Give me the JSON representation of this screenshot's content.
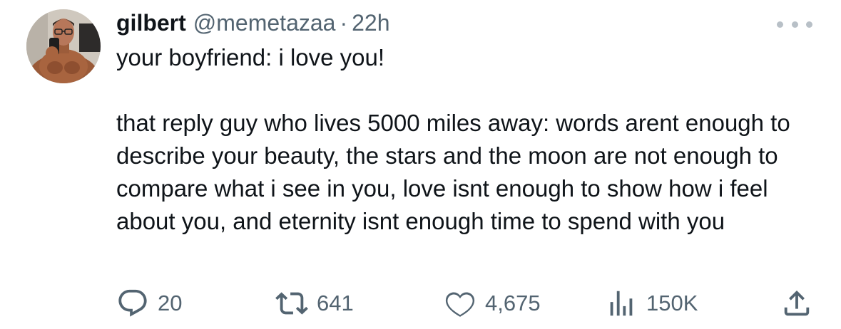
{
  "author": {
    "display_name": "gilbert",
    "handle": "@memetazaa",
    "separator": "·",
    "time": "22h"
  },
  "tweet": {
    "line1": "your boyfriend: i love you!",
    "line2": "that reply guy who lives 5000 miles away: words arent enough to describe your beauty, the stars and the moon are not enough to compare what i see in you, love isnt enough to show how i feel about you, and eternity isnt enough time to spend with you"
  },
  "actions": {
    "replies": "20",
    "reposts": "641",
    "likes": "4,675",
    "views": "150K"
  },
  "icons": {
    "reply": "reply-icon",
    "repost": "repost-icon",
    "like": "heart-icon",
    "views": "views-bar-icon",
    "share": "share-icon",
    "more": "more-dots-icon"
  },
  "colors": {
    "text": "#0f1419",
    "secondary": "#536471",
    "icon": "#536471"
  }
}
